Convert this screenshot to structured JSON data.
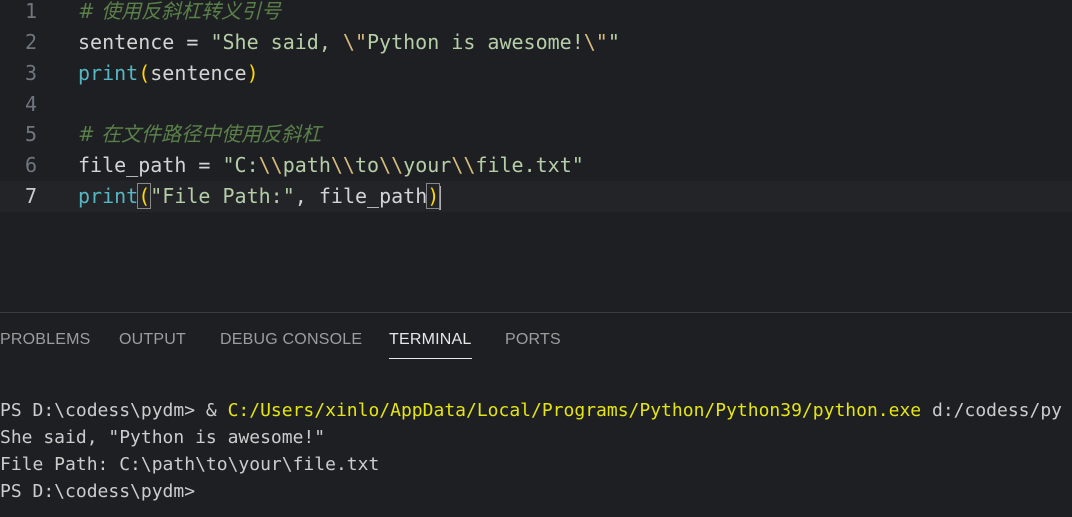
{
  "editor": {
    "lines": [
      {
        "number": "1",
        "comment": "# 使用反斜杠转义引号"
      },
      {
        "number": "2",
        "var": "sentence",
        "op": " = ",
        "str_open": "\"She said, ",
        "esc1": "\\\"",
        "str_mid": "Python is awesome!",
        "esc2": "\\\"",
        "str_close": "\""
      },
      {
        "number": "3",
        "func": "print",
        "paren_open": "(",
        "arg": "sentence",
        "paren_close": ")"
      },
      {
        "number": "4"
      },
      {
        "number": "5",
        "comment": "# 在文件路径中使用反斜杠"
      },
      {
        "number": "6",
        "var": "file_path",
        "op": " = ",
        "str_open": "\"C:",
        "esc1": "\\\\",
        "seg1": "path",
        "esc2": "\\\\",
        "seg2": "to",
        "esc3": "\\\\",
        "seg3": "your",
        "esc4": "\\\\",
        "seg4": "file.txt",
        "str_close": "\""
      },
      {
        "number": "7",
        "func": "print",
        "paren_open": "(",
        "str": "\"File Path:\"",
        "comma": ", ",
        "arg": "file_path",
        "paren_close": ")"
      }
    ]
  },
  "panel": {
    "tabs": [
      {
        "label": "PROBLEMS",
        "active": false
      },
      {
        "label": "OUTPUT",
        "active": false
      },
      {
        "label": "DEBUG CONSOLE",
        "active": false
      },
      {
        "label": "TERMINAL",
        "active": true
      },
      {
        "label": "PORTS",
        "active": false
      }
    ]
  },
  "terminal": {
    "line1_prompt": "PS D:\\codess\\pydm> & ",
    "line1_exe": "C:/Users/xinlo/AppData/Local/Programs/Python/Python39/python.exe",
    "line1_arg": " d:/codess/py",
    "line2": "She said, \"Python is awesome!\"",
    "line3": "File Path: C:\\path\\to\\your\\file.txt",
    "line4": "PS D:\\codess\\pydm>"
  },
  "colors": {
    "background": "#1e1f22",
    "comment": "#6a9955",
    "string": "#ce9178",
    "function": "#4fc1ff",
    "bracket": "#ffd700",
    "terminal_path": "#e5e510"
  }
}
